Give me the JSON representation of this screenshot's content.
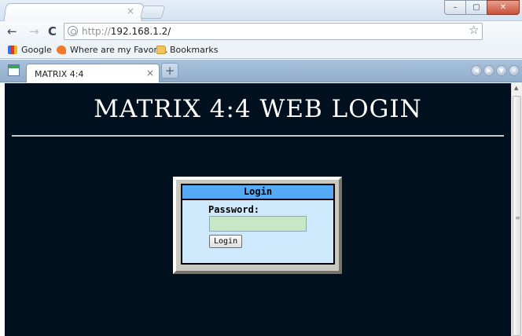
{
  "window": {
    "outer_tab_close": "×",
    "minimize_icon": "minimize-icon",
    "maximize_icon": "maximize-icon",
    "close_icon": "close-icon",
    "minimize_glyph": "–",
    "maximize_glyph": "▢",
    "close_glyph": "✕"
  },
  "toolbar": {
    "back_glyph": "←",
    "forward_glyph": "→",
    "reload_glyph": "C",
    "url_scheme": "http://",
    "url_host": "192.168.1.2/",
    "star_glyph": "☆"
  },
  "bookmarks": [
    {
      "label": "Google",
      "icon": "google-icon"
    },
    {
      "label": "Where are my Favori...",
      "icon": "favorites-icon"
    },
    {
      "label": "Bookmarks",
      "icon": "folder-icon"
    }
  ],
  "inner_tabs": {
    "active_label": "MATRIX 4:4",
    "close_glyph": "×",
    "newtab_glyph": "+",
    "ctrls": [
      "◀",
      "▶",
      "▼",
      "✕"
    ]
  },
  "page": {
    "heading": "MATRIX 4:4 WEB LOGIN",
    "login": {
      "title": "Login",
      "password_label": "Password:",
      "password_value": "",
      "button_label": "Login"
    }
  },
  "scrollbar": {
    "up_glyph": "▲",
    "grip_glyph": "≡"
  },
  "colors": {
    "page_background": "#00101e",
    "login_header": "#55aaf6",
    "login_body": "#cde9fb",
    "password_field": "#c6e8c4"
  }
}
